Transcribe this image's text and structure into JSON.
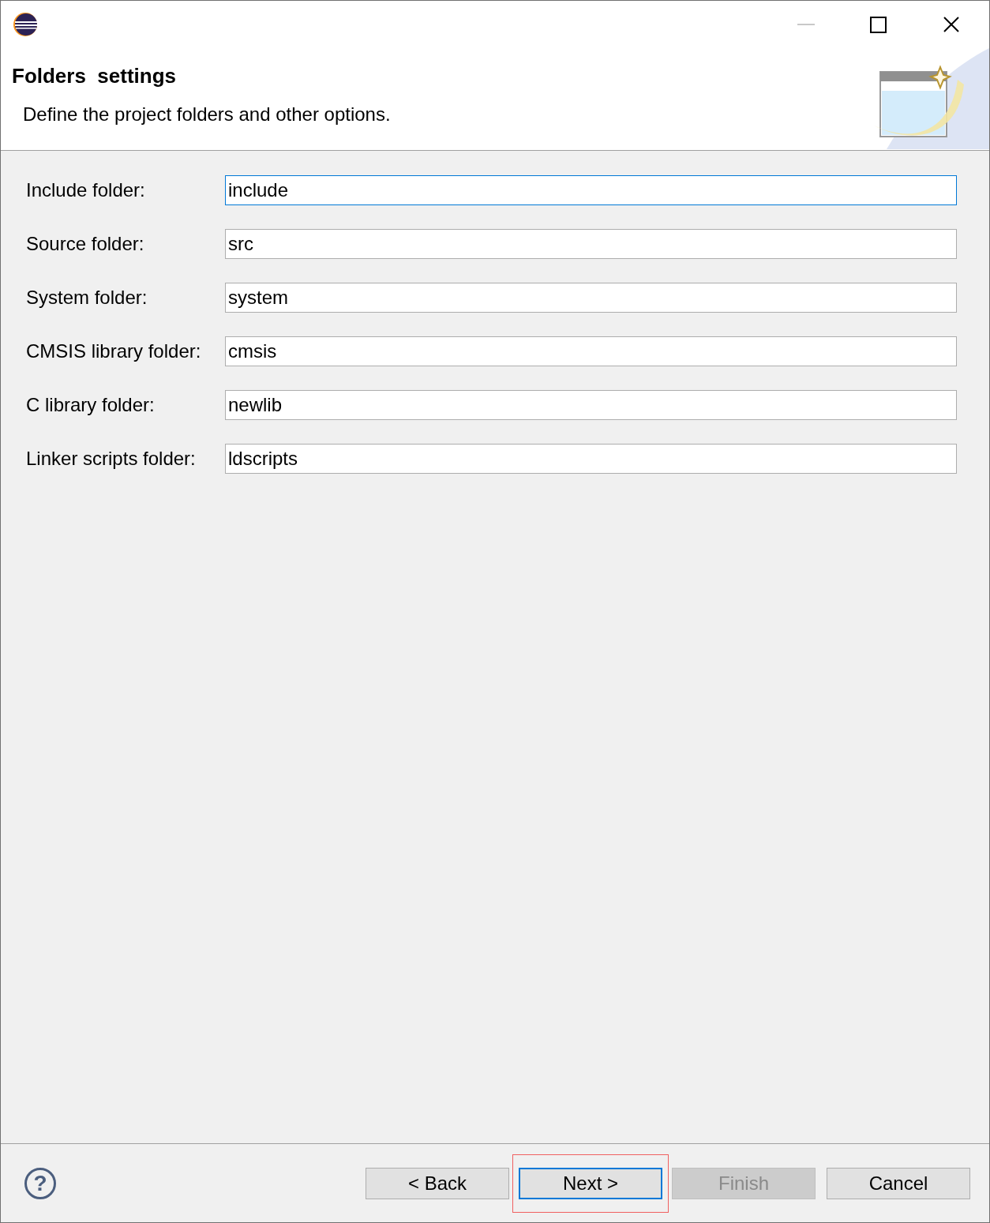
{
  "header": {
    "title": "Folders  settings",
    "description": "Define the project folders and other options."
  },
  "fields": [
    {
      "label": "Include folder:",
      "value": "include",
      "focused": true
    },
    {
      "label": "Source folder:",
      "value": "src",
      "focused": false
    },
    {
      "label": "System folder:",
      "value": "system",
      "focused": false
    },
    {
      "label": "CMSIS library folder:",
      "value": "cmsis",
      "focused": false
    },
    {
      "label": "C library folder:",
      "value": "newlib",
      "focused": false
    },
    {
      "label": "Linker scripts folder:",
      "value": "ldscripts",
      "focused": false
    }
  ],
  "help_button": {
    "label": "?"
  },
  "buttons": [
    {
      "label": "< Back",
      "disabled": false,
      "default": false,
      "highlighted": false
    },
    {
      "label": "Next >",
      "disabled": false,
      "default": true,
      "highlighted": true
    },
    {
      "label": "Finish",
      "disabled": true,
      "default": false,
      "highlighted": false
    },
    {
      "label": "Cancel",
      "disabled": false,
      "default": false,
      "highlighted": false
    }
  ]
}
